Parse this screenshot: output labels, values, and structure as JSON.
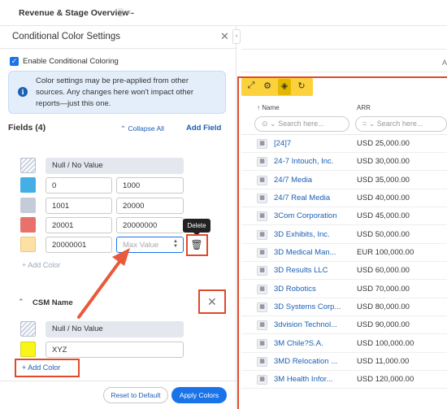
{
  "top_bar": {
    "title": "Revenue & Stage Overview -",
    "icons": "▒ ≡"
  },
  "panel": {
    "title": "Conditional Color Settings",
    "enable_label": "Enable Conditional Coloring",
    "info_text": "Color settings may be pre-applied from other sources. Any changes here won't impact other reports—just this one.",
    "fields_label": "Fields (4)",
    "collapse_all": "Collapse All",
    "add_field": "Add Field",
    "rules": [
      {
        "null_label": "Null / No Value",
        "color": "hatched"
      },
      {
        "min": "0",
        "max": "1000",
        "color": "#44aee7"
      },
      {
        "min": "1001",
        "max": "20000",
        "color": "#c5ccd9"
      },
      {
        "min": "20001",
        "max": "20000000",
        "color": "#e8726b"
      },
      {
        "min": "20000001",
        "max_placeholder": "Max Value",
        "color": "#fde0a6"
      }
    ],
    "delete_tooltip": "Delete",
    "add_color_1": "+ Add Color",
    "csm_label": "CSM Name",
    "csm_rules": [
      {
        "null_label": "Null / No Value",
        "color": "hatched"
      },
      {
        "value": "XYZ",
        "color": "#f8f518"
      }
    ],
    "add_color_2": "+ Add Color",
    "reset_btn": "Reset to Default",
    "apply_btn": "Apply Colors"
  },
  "table": {
    "stub": "A",
    "col_name": "↑ Name",
    "col_arr": "ARR",
    "filter_name": "⊙ ⌄  Search here...",
    "filter_arr": "=  ⌄   Search here...",
    "rows": [
      {
        "name": "[24]7",
        "arr": "USD 25,000.00"
      },
      {
        "name": "24-7 Intouch, Inc.",
        "arr": "USD 30,000.00"
      },
      {
        "name": "24/7 Media",
        "arr": "USD 35,000.00"
      },
      {
        "name": "24/7 Real Media",
        "arr": "USD 40,000.00"
      },
      {
        "name": "3Com Corporation",
        "arr": "USD 45,000.00"
      },
      {
        "name": "3D Exhibits, Inc.",
        "arr": "USD 50,000.00"
      },
      {
        "name": "3D Medical Man...",
        "arr": "EUR 100,000.00"
      },
      {
        "name": "3D Results LLC",
        "arr": "USD 60,000.00"
      },
      {
        "name": "3D Robotics",
        "arr": "USD 70,000.00"
      },
      {
        "name": "3D Systems Corp...",
        "arr": "USD 80,000.00"
      },
      {
        "name": "3dvision Technol...",
        "arr": "USD 90,000.00"
      },
      {
        "name": "3M Chile?S.A.",
        "arr": "USD 100,000.00"
      },
      {
        "name": "3MD Relocation ...",
        "arr": "USD 11,000.00"
      },
      {
        "name": "3M Health Infor...",
        "arr": "USD 120,000.00"
      }
    ]
  },
  "colors": {
    "accent": "#1a73e8",
    "highlight": "#e04a2b",
    "toolbar": "#fcd23c"
  }
}
